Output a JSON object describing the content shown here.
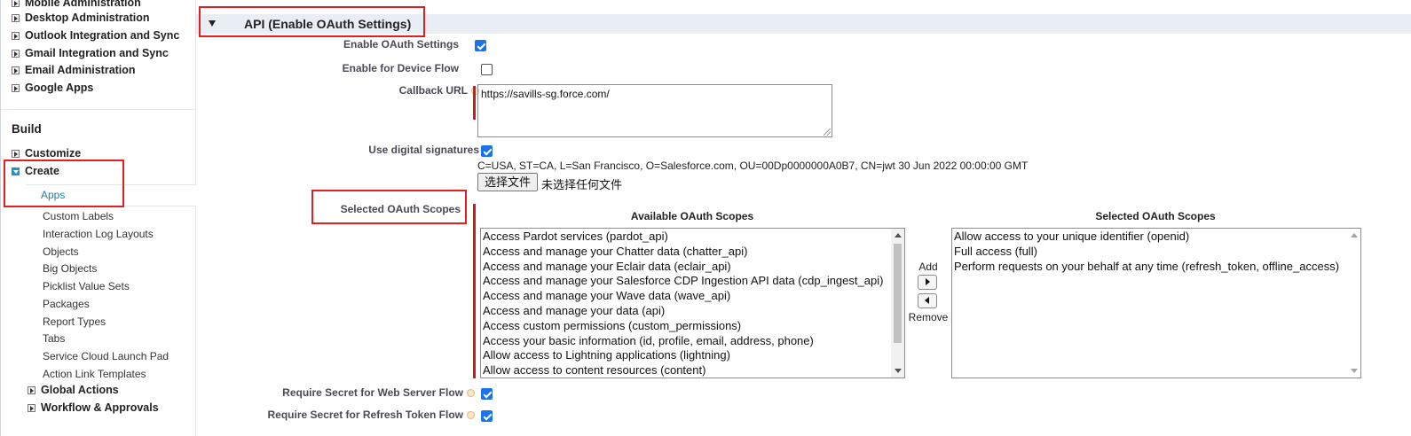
{
  "sidebar": {
    "items_top": [
      {
        "label": "Mobile Administration"
      },
      {
        "label": "Desktop Administration"
      },
      {
        "label": "Outlook Integration and Sync"
      },
      {
        "label": "Gmail Integration and Sync"
      },
      {
        "label": "Email Administration"
      },
      {
        "label": "Google Apps"
      }
    ],
    "build_header": "Build",
    "customize": "Customize",
    "create": "Create",
    "apps": "Apps",
    "create_children": [
      "Custom Labels",
      "Interaction Log Layouts",
      "Objects",
      "Big Objects",
      "Picklist Value Sets",
      "Packages",
      "Report Types",
      "Tabs",
      "Service Cloud Launch Pad",
      "Action Link Templates"
    ],
    "global_actions": "Global Actions",
    "workflow": "Workflow & Approvals"
  },
  "section": {
    "title": "API (Enable OAuth Settings)"
  },
  "form": {
    "enable_oauth_label": "Enable OAuth Settings",
    "enable_oauth_checked": true,
    "device_flow_label": "Enable for Device Flow",
    "device_flow_checked": false,
    "callback_label": "Callback URL",
    "callback_value": "https://savills-sg.force.com/",
    "digital_sig_label": "Use digital signatures",
    "digital_sig_checked": true,
    "cert_text": "C=USA, ST=CA, L=San Francisco, O=Salesforce.com, OU=00Dp0000000A0B7, CN=jwt 30 Jun 2022 00:00:00 GMT",
    "file_button": "选择文件",
    "file_none": "未选择任何文件",
    "scopes_label": "Selected OAuth Scopes",
    "available_header": "Available OAuth Scopes",
    "selected_header": "Selected OAuth Scopes",
    "available_scopes": [
      "Access Pardot services (pardot_api)",
      "Access and manage your Chatter data (chatter_api)",
      "Access and manage your Eclair data (eclair_api)",
      "Access and manage your Salesforce CDP Ingestion API data (cdp_ingest_api)",
      "Access and manage your Wave data (wave_api)",
      "Access and manage your data (api)",
      "Access custom permissions (custom_permissions)",
      "Access your basic information (id, profile, email, address, phone)",
      "Allow access to Lightning applications (lightning)",
      "Allow access to content resources (content)"
    ],
    "selected_scopes": [
      "Allow access to your unique identifier (openid)",
      "Full access (full)",
      "Perform requests on your behalf at any time (refresh_token, offline_access)"
    ],
    "add_label": "Add",
    "remove_label": "Remove",
    "secret_web_label": "Require Secret for Web Server Flow",
    "secret_web_checked": true,
    "secret_refresh_label": "Require Secret for Refresh Token Flow",
    "secret_refresh_checked": true
  },
  "colors": {
    "highlight_red": "#e02020",
    "required_bar": "#c51d22",
    "section_bar": "#e9edf4",
    "link_blue": "#1b7fa6",
    "checkbox_blue": "#1a73e8"
  }
}
